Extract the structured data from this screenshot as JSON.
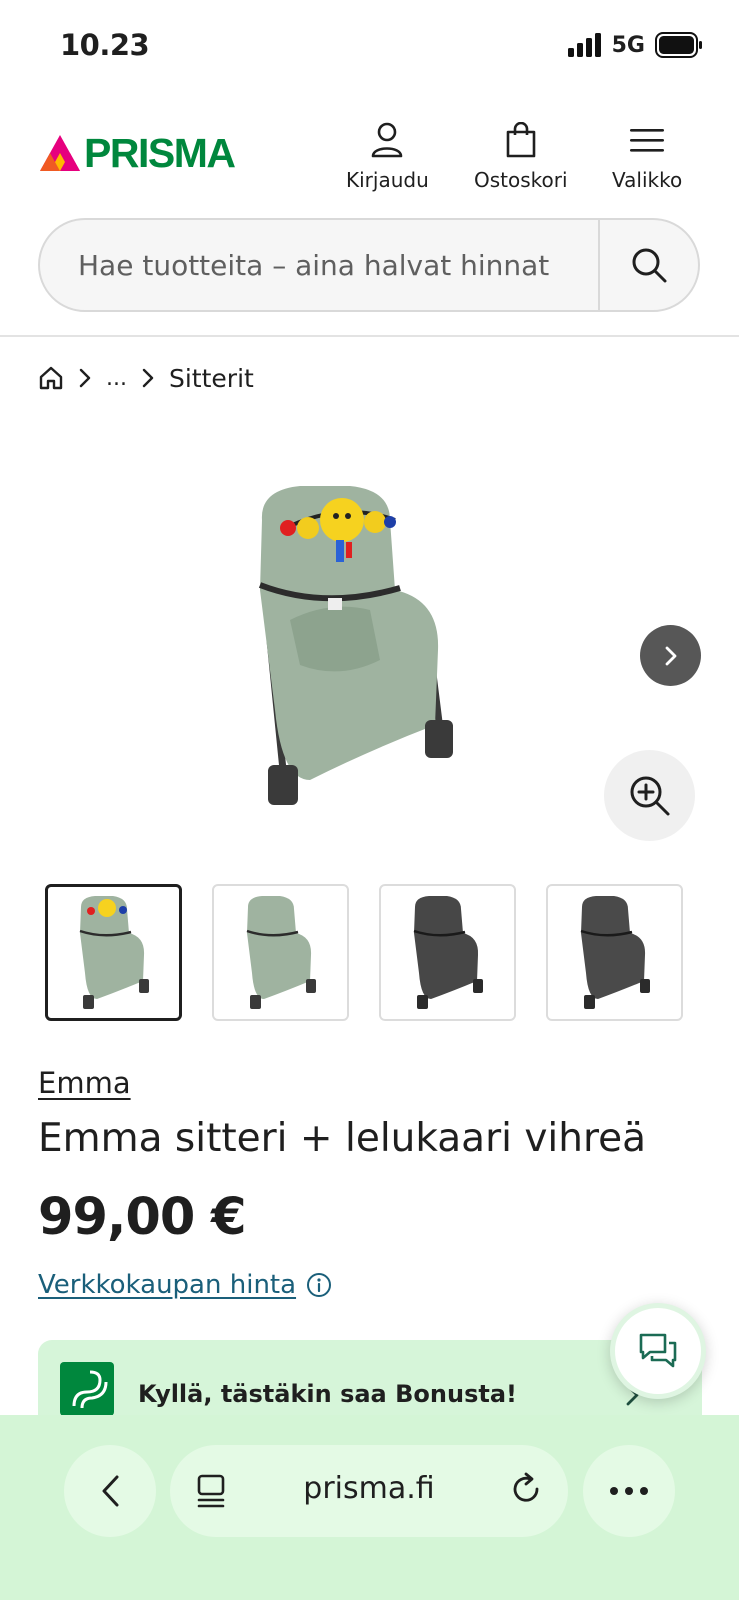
{
  "status_bar": {
    "time": "10.23",
    "network": "5G"
  },
  "header": {
    "logo_text": "PRISMA",
    "login_label": "Kirjaudu",
    "cart_label": "Ostoskori",
    "menu_label": "Valikko"
  },
  "search": {
    "placeholder": "Hae tuotteita – aina halvat hinnat"
  },
  "breadcrumb": {
    "ellipsis": "...",
    "current": "Sitterit"
  },
  "product": {
    "brand": "Emma",
    "title": "Emma sitteri + lelukaari vihreä",
    "price": "99,00 €",
    "price_info": "Verkkokaupan hinta"
  },
  "bonus": {
    "text": "Kyllä, tästäkin saa Bonusta!"
  },
  "browser": {
    "url": "prisma.fi"
  },
  "colors": {
    "brand_green": "#00873d",
    "link_teal": "#1a5f7a",
    "bonus_bg": "#d6f5d9",
    "browser_bar_bg": "#d4f5d6"
  }
}
